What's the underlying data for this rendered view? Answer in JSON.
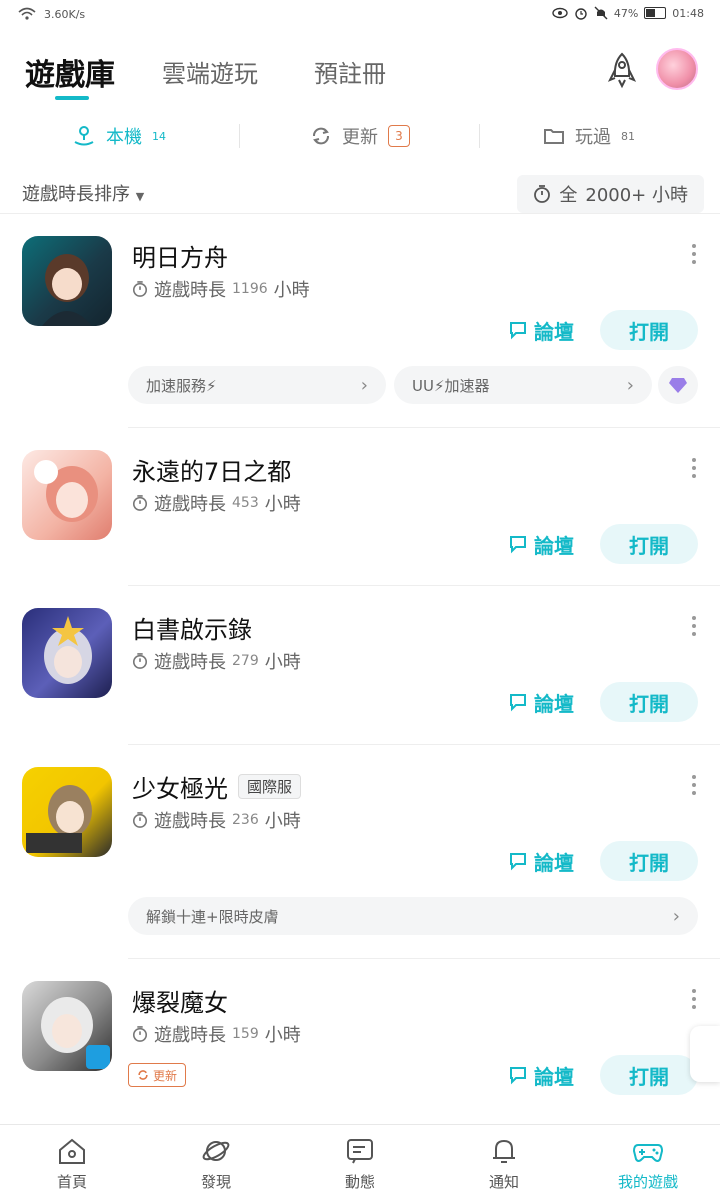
{
  "status_bar": {
    "speed": "3.60K/s",
    "battery": "47%",
    "time": "01:48",
    "battery_level": 0.47
  },
  "header": {
    "tabs": [
      {
        "label": "遊戲庫"
      },
      {
        "label": "雲端遊玩"
      },
      {
        "label": "預註冊"
      }
    ]
  },
  "sub_tabs": [
    {
      "label": "本機",
      "count": "14"
    },
    {
      "label": "更新",
      "count": "3"
    },
    {
      "label": "玩過",
      "count": "81"
    }
  ],
  "sort": {
    "label": "遊戲時長排序",
    "filter": "2000+ 小時",
    "filter_prefix": "全"
  },
  "common": {
    "playtime_label": "遊戲時長",
    "hours_unit": "小時",
    "forum_label": "論壇",
    "open_label": "打開",
    "update_label": "更新"
  },
  "games": [
    {
      "name": "明日方舟",
      "hours": "1196",
      "pills": [
        "加速服務⚡",
        "UU⚡加速器"
      ]
    },
    {
      "name": "永遠的7日之都",
      "hours": "453"
    },
    {
      "name": "白書啟示錄",
      "hours": "279"
    },
    {
      "name": "少女極光",
      "tag": "國際服",
      "hours": "236",
      "pills": [
        "解鎖十連+限時皮膚"
      ]
    },
    {
      "name": "爆裂魔女",
      "hours": "159"
    }
  ],
  "bottom_nav": [
    {
      "label": "首頁",
      "icon": "home-icon"
    },
    {
      "label": "發現",
      "icon": "planet-icon"
    },
    {
      "label": "動態",
      "icon": "feed-icon"
    },
    {
      "label": "通知",
      "icon": "bell-icon"
    },
    {
      "label": "我的遊戲",
      "icon": "gamepad-icon"
    }
  ],
  "colors": {
    "accent": "#14b9c8",
    "update": "#e07a4a"
  }
}
